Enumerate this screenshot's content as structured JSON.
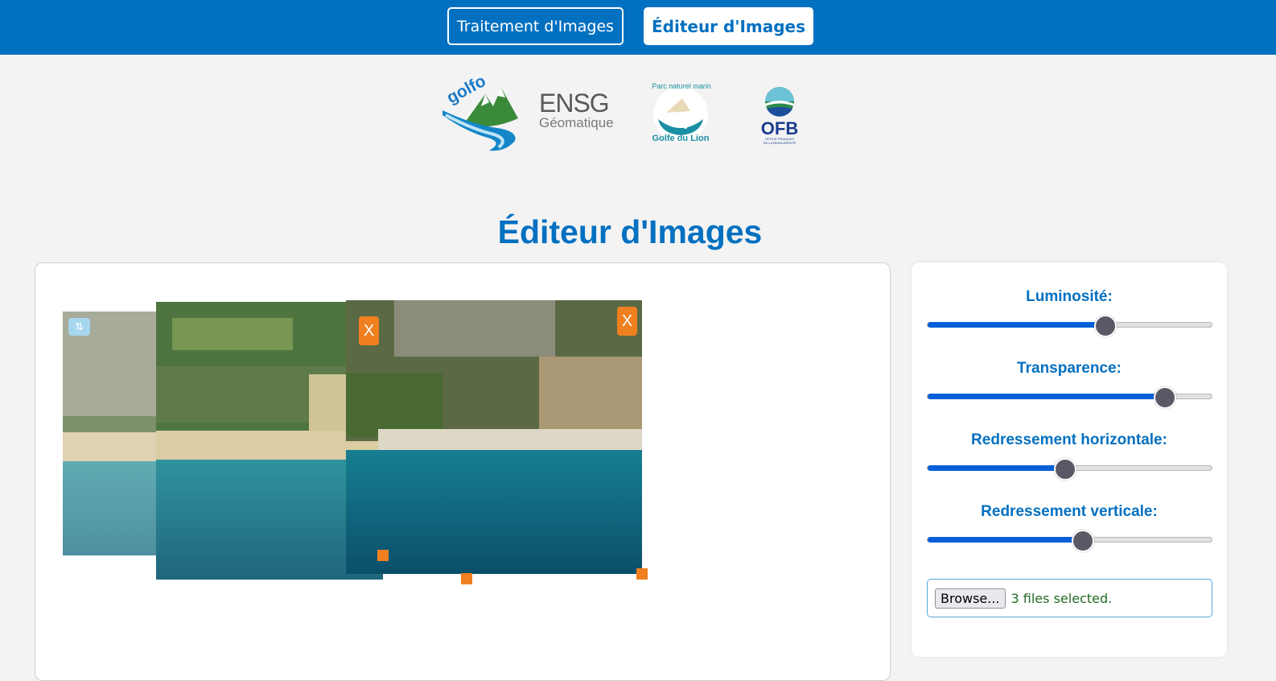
{
  "nav": {
    "tab_processing": "Traitement d'Images",
    "tab_editor": "Éditeur d'Images"
  },
  "logos": {
    "golfo": "golfo",
    "ensg_main": "ENSG",
    "ensg_sub": "Géomatique",
    "parc_top": "Parc naturel marin",
    "parc_bottom": "Golfe du Lion",
    "ofb": "OFB",
    "ofb_line1": "OFFICE FRANÇAIS",
    "ofb_line2": "DE LA BIODIVERSITÉ"
  },
  "page_title": "Éditeur d'Images",
  "canvas": {
    "close_label": "X",
    "swap_label": "⇅"
  },
  "controls": {
    "brightness_label": "Luminosité:",
    "brightness_value": 0.62,
    "transparency_label": "Transparence:",
    "transparency_value": 0.83,
    "hstraighten_label": "Redressement horizontale:",
    "hstraighten_value": 0.48,
    "vstraighten_label": "Redressement verticale:",
    "vstraighten_value": 0.54,
    "browse_label": "Browse...",
    "file_status": "3 files selected."
  },
  "colors": {
    "brand_blue": "#0270c0",
    "accent_orange": "#f0801f",
    "slider_fill": "#0560d8"
  }
}
